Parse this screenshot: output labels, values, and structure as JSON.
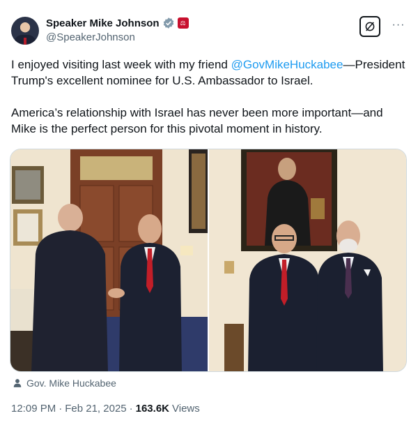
{
  "author": {
    "display_name": "Speaker Mike Johnson",
    "handle": "@SpeakerJohnson",
    "verified_icon": "verified-badge-icon",
    "affiliation_icon": "government-badge-icon"
  },
  "actions": {
    "grok_icon": "grok-icon",
    "more_label": "···"
  },
  "body": {
    "para1_before": "I enjoyed visiting last week with my friend ",
    "para1_mention": "@GovMikeHuckabee",
    "para1_after": "—President Trump's excellent nominee for U.S. Ambassador to Israel.",
    "para2": "America’s relationship with Israel has never been more important—and Mike is the perfect person for this pivotal moment in history."
  },
  "media": {
    "tagged_user": "Gov. Mike Huckabee"
  },
  "meta": {
    "time": "12:09 PM",
    "sep1": "·",
    "date": "Feb 21, 2025",
    "sep2": "·",
    "views_count": "163.6K",
    "views_label": "Views"
  },
  "colors": {
    "link": "#1d9bf0",
    "secondary_text": "#536471",
    "verified": "#829aab",
    "gov_badge": "#c8102e"
  }
}
